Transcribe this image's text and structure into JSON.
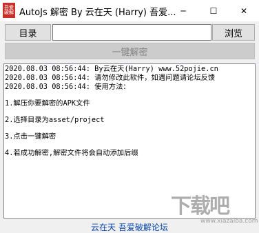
{
  "window": {
    "title": "AutoJs 解密 By 云在天 (Harry) 吾爱...",
    "icon_label": "吾爱破解",
    "minimize": "─",
    "maximize": "☐",
    "close": "✕"
  },
  "toolbar": {
    "dir_button": "目录",
    "path_value": "",
    "browse_button": "浏览",
    "decrypt_button": "一键解密"
  },
  "log": {
    "lines": [
      "2020.08.03 08:56:44: By云在天(Harry) www.52pojie.cn",
      "2020.08.03 08:56:44: 请勿修改此软件，如遇问题请论坛反馈",
      "2020.08.03 08:56:44: 使用方法：",
      "1.解压你要解密的APK文件",
      "2.选择目录为asset/project",
      "3.点击一键解密",
      "4.若成功解密,解密文件将会自动添加后缀"
    ]
  },
  "status": {
    "link_text": "云在天 吾爱破解论坛"
  },
  "watermark": {
    "text": "下载吧",
    "url": "www.xiazaiba.com"
  }
}
